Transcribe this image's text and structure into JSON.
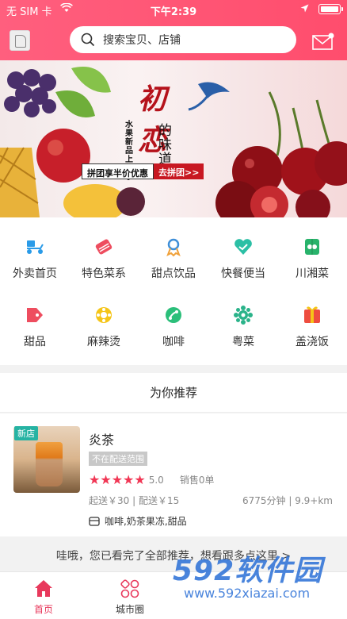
{
  "status_bar": {
    "carrier": "无 SIM 卡",
    "time": "下午2:39"
  },
  "search": {
    "placeholder": "搜索宝贝、店铺"
  },
  "banner": {
    "title_big": "初恋",
    "title_sub": "的味道",
    "side_text": "水果新品上新季",
    "promo_text": "拼团享半价优惠",
    "promo_cta": "去拼团>>"
  },
  "categories": [
    {
      "label": "外卖首页",
      "icon": "delivery-scooter-icon",
      "color": "#2a9be8"
    },
    {
      "label": "特色菜系",
      "icon": "chopsticks-icon",
      "color": "#ee4d5f"
    },
    {
      "label": "甜点饮品",
      "icon": "ribbon-icon",
      "color": "#3f8fd8"
    },
    {
      "label": "快餐便当",
      "icon": "heart-check-icon",
      "color": "#2bbfa5"
    },
    {
      "label": "川湘菜",
      "icon": "pepper-icon",
      "color": "#28b36b"
    },
    {
      "label": "甜品",
      "icon": "tag-icon",
      "color": "#ee4d5f"
    },
    {
      "label": "麻辣烫",
      "icon": "flower-icon",
      "color": "#f5c518"
    },
    {
      "label": "咖啡",
      "icon": "coffee-bean-icon",
      "color": "#2bbf7a"
    },
    {
      "label": "粤菜",
      "icon": "gear-flower-icon",
      "color": "#2bb38a"
    },
    {
      "label": "盖浇饭",
      "icon": "gift-icon",
      "color": "#ee4d3f"
    }
  ],
  "recommend": {
    "title": "为你推荐"
  },
  "shop": {
    "badge": "新店",
    "name": "炎茶",
    "range_tag": "不在配送范围",
    "rating": 5.0,
    "rating_text": "5.0",
    "sales": "销售0单",
    "fees": "起送￥30 | 配送￥15",
    "distance": "6775分钟 | 9.9+km",
    "categories_text": "咖啡,奶茶果冻,甜品"
  },
  "end_text": "哇哦，您已看完了全部推荐，想看跟多点这里 >",
  "tabs": [
    {
      "label": "首页",
      "icon": "home-icon",
      "active": true
    },
    {
      "label": "城市圈",
      "icon": "grid-circles-icon",
      "active": false
    }
  ],
  "watermark": {
    "big": "592软件园",
    "small": "www.592xiazai.com"
  },
  "colors": {
    "accent": "#ff4d6d",
    "star": "#f13654",
    "promo_red": "#c81822",
    "new_badge": "#26b3a3"
  }
}
